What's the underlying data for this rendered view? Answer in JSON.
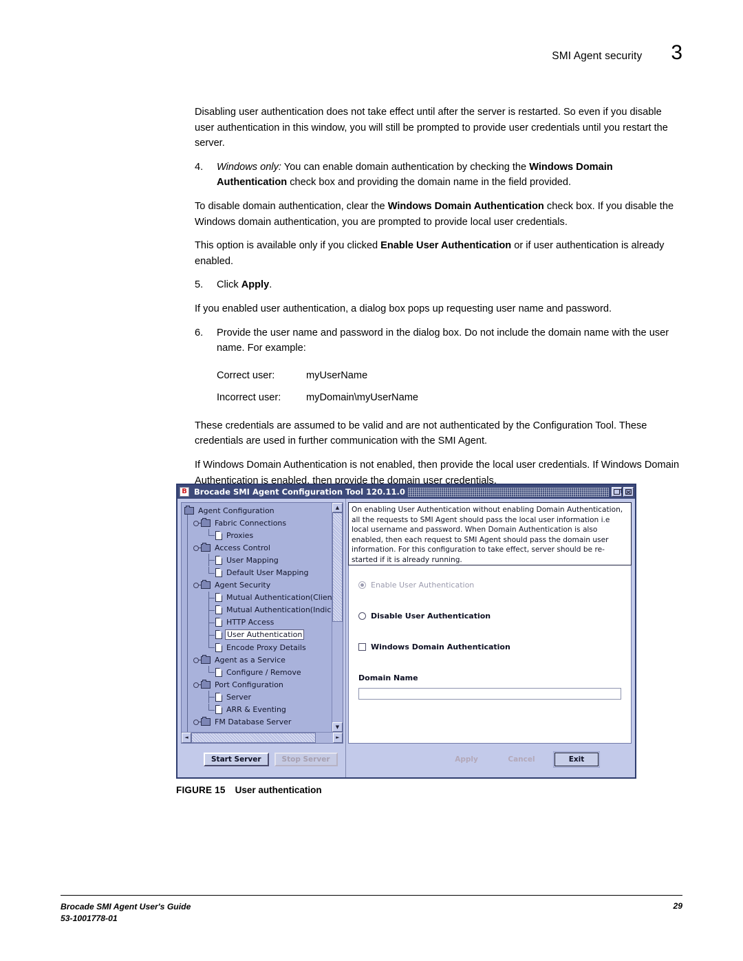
{
  "header": {
    "running_head": "SMI Agent security",
    "chapter_number": "3"
  },
  "body": {
    "intro_paragraph": "Disabling user authentication does not take effect until after the server is restarted. So even if you disable user authentication in this window, you will still be prompted to provide user credentials until you restart the server.",
    "step4": {
      "number": "4.",
      "lead_italic": "Windows only:",
      "text_a": " You can enable domain authentication by checking the ",
      "bold_a": "Windows Domain Authentication",
      "text_b": " check box and providing the domain name in the field provided."
    },
    "para_disable": {
      "text_a": "To disable domain authentication, clear the ",
      "bold_a": "Windows Domain Authentication",
      "text_b": " check box. If you disable the Windows domain authentication, you are prompted to provide local user credentials."
    },
    "para_option": {
      "text_a": "This option is available only if you clicked ",
      "bold_a": "Enable User Authentication",
      "text_b": " or if user authentication is already enabled."
    },
    "step5": {
      "number": "5.",
      "text_a": "Click ",
      "bold_a": "Apply",
      "text_b": "."
    },
    "para_dialog": "If you enabled user authentication, a dialog box pops up requesting user name and password.",
    "step6": {
      "number": "6.",
      "text": "Provide the user name and password in the dialog box. Do not include the domain name with the user name. For example:"
    },
    "examples": [
      {
        "label": "Correct user:",
        "value": "myUserName"
      },
      {
        "label": "Incorrect user:",
        "value": "myDomain\\myUserName"
      }
    ],
    "para_credentials": "These credentials are assumed to be valid and are not authenticated by the Configuration Tool. These credentials are used in further communication with the SMI Agent.",
    "para_windows": "If Windows Domain Authentication is not enabled, then provide the local user credentials. If Windows Domain Authentication is enabled, then provide the domain user credentials."
  },
  "figure": {
    "caption_tag": "FIGURE 15",
    "caption_title": "User authentication",
    "window": {
      "title": "Brocade SMI Agent Configuration Tool 120.11.0",
      "icon_label": "B",
      "controls": {
        "restore_label": "restore",
        "close_label": "close"
      },
      "tree": [
        {
          "label": "Agent Configuration",
          "level": 0,
          "icon": "folder-icon",
          "handle": false,
          "elbow": "none",
          "selected": false
        },
        {
          "label": "Fabric Connections",
          "level": 1,
          "icon": "folder-icon",
          "handle": true,
          "elbow": "none",
          "selected": false
        },
        {
          "label": "Proxies",
          "level": 2,
          "icon": "document-icon",
          "handle": false,
          "elbow": "last",
          "selected": false
        },
        {
          "label": "Access Control",
          "level": 1,
          "icon": "folder-icon",
          "handle": true,
          "elbow": "none",
          "selected": false
        },
        {
          "label": "User Mapping",
          "level": 2,
          "icon": "document-icon",
          "handle": false,
          "elbow": "tee",
          "selected": false
        },
        {
          "label": "Default User Mapping",
          "level": 2,
          "icon": "document-icon",
          "handle": false,
          "elbow": "last",
          "selected": false
        },
        {
          "label": "Agent Security",
          "level": 1,
          "icon": "folder-icon",
          "handle": true,
          "elbow": "none",
          "selected": false
        },
        {
          "label": "Mutual Authentication(Client)",
          "level": 2,
          "icon": "document-icon",
          "handle": false,
          "elbow": "tee",
          "selected": false
        },
        {
          "label": "Mutual Authentication(Indication)",
          "level": 2,
          "icon": "document-icon",
          "handle": false,
          "elbow": "tee",
          "selected": false
        },
        {
          "label": "HTTP Access",
          "level": 2,
          "icon": "document-icon",
          "handle": false,
          "elbow": "tee",
          "selected": false
        },
        {
          "label": "User Authentication",
          "level": 2,
          "icon": "document-icon",
          "handle": false,
          "elbow": "tee",
          "selected": true
        },
        {
          "label": "Encode Proxy Details",
          "level": 2,
          "icon": "document-icon",
          "handle": false,
          "elbow": "last",
          "selected": false
        },
        {
          "label": "Agent as a Service",
          "level": 1,
          "icon": "folder-icon",
          "handle": true,
          "elbow": "none",
          "selected": false
        },
        {
          "label": "Configure / Remove",
          "level": 2,
          "icon": "document-icon",
          "handle": false,
          "elbow": "last",
          "selected": false
        },
        {
          "label": "Port Configuration",
          "level": 1,
          "icon": "folder-icon",
          "handle": true,
          "elbow": "none",
          "selected": false
        },
        {
          "label": "Server",
          "level": 2,
          "icon": "document-icon",
          "handle": false,
          "elbow": "tee",
          "selected": false
        },
        {
          "label": "ARR & Eventing",
          "level": 2,
          "icon": "document-icon",
          "handle": false,
          "elbow": "last",
          "selected": false
        },
        {
          "label": "FM Database Server",
          "level": 1,
          "icon": "folder-icon",
          "handle": true,
          "elbow": "none",
          "selected": false
        }
      ],
      "description": "On enabling User Authentication without enabling Domain Authentication, all the requests to SMI Agent should pass the local user information i.e local username and password. When Domain Authentication is also enabled, then each request to SMI Agent should pass the domain user information. For this configuration to take effect, server should be re-started if it is already running.",
      "controls_form": {
        "enable_radio_label": "Enable User Authentication",
        "disable_radio_label": "Disable User Authentication",
        "windows_domain_checkbox_label": "Windows Domain Authentication",
        "domain_name_label": "Domain Name",
        "domain_name_value": "",
        "domain_name_placeholder": ""
      },
      "buttons": {
        "start_server": "Start Server",
        "stop_server": "Stop Server",
        "apply": "Apply",
        "cancel": "Cancel",
        "exit": "Exit"
      },
      "scrollbar": {
        "up_arrow": "▲",
        "down_arrow": "▼",
        "left_arrow": "◄",
        "right_arrow": "►"
      }
    }
  },
  "footer": {
    "guide_title": "Brocade SMI Agent User's Guide",
    "doc_number": "53-1001778-01",
    "page_number": "29"
  },
  "colors": {
    "titlebar": "#3d4a7a",
    "window_face": "#c3caea",
    "tree_face": "#a9b2db",
    "accent_red": "#cf1b20"
  }
}
